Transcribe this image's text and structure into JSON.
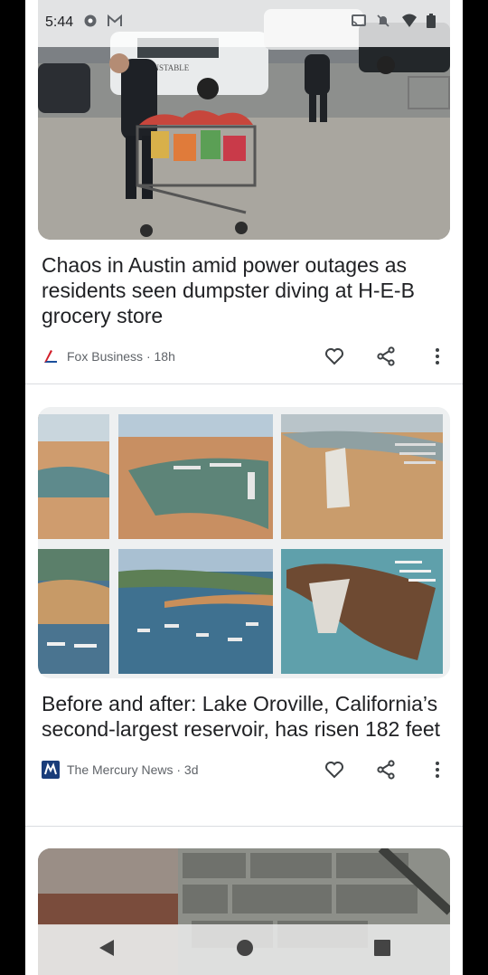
{
  "status": {
    "time": "5:44"
  },
  "articles": [
    {
      "headline": "Chaos in Austin amid power outages as residents seen dumpster diving at H-E-B grocery store",
      "source": "Fox Business",
      "age": "18h",
      "photo_text": "CONSTABLE"
    },
    {
      "headline": "Before and after: Lake Oroville, California’s second-largest reservoir, has risen 182 feet",
      "source": "The Mercury News",
      "age": "3d"
    }
  ],
  "colors": {
    "fox_red": "#d21f2a",
    "fox_blue": "#1a4f9c",
    "mercury_blue": "#1a3d7a",
    "text": "#202124",
    "meta": "#5f6368"
  },
  "icons": [
    "heart-icon",
    "share-icon",
    "more-vert-icon",
    "back-icon",
    "home-icon",
    "recents-icon"
  ]
}
